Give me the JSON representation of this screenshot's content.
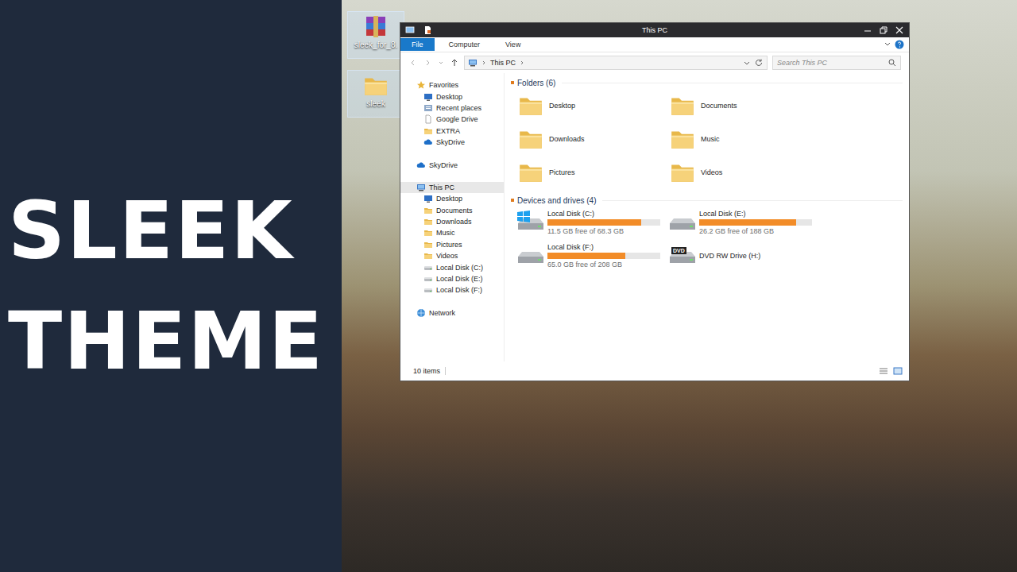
{
  "banner": {
    "lines": [
      "SLEEK",
      "THEME"
    ]
  },
  "desktop_icons": [
    {
      "label": "sleek_for_8.",
      "kind": "archive",
      "selected": true
    },
    {
      "label": "sleek",
      "kind": "folder",
      "selected": true
    }
  ],
  "window": {
    "title": "This PC"
  },
  "ribbon_tabs": [
    {
      "label": "File",
      "selected": true
    },
    {
      "label": "Computer",
      "selected": false
    },
    {
      "label": "View",
      "selected": false
    }
  ],
  "address": {
    "path": "This PC"
  },
  "search": {
    "placeholder": "Search This PC"
  },
  "sidebar": [
    {
      "label": "Favorites",
      "kind": "star",
      "selected": false,
      "items": [
        {
          "label": "Desktop",
          "kind": "desktop",
          "selected": false
        },
        {
          "label": "Recent places",
          "kind": "recent",
          "selected": false
        },
        {
          "label": "Google Drive",
          "kind": "file",
          "selected": false
        },
        {
          "label": "EXTRA",
          "kind": "folder",
          "selected": false
        },
        {
          "label": "SkyDrive",
          "kind": "cloud",
          "selected": false
        }
      ]
    },
    {
      "label": "SkyDrive",
      "kind": "cloud",
      "selected": false,
      "items": []
    },
    {
      "label": "This PC",
      "kind": "pc",
      "selected": true,
      "items": [
        {
          "label": "Desktop",
          "kind": "desktop",
          "selected": false
        },
        {
          "label": "Documents",
          "kind": "folder",
          "selected": false
        },
        {
          "label": "Downloads",
          "kind": "folder",
          "selected": false
        },
        {
          "label": "Music",
          "kind": "folder",
          "selected": false
        },
        {
          "label": "Pictures",
          "kind": "folder",
          "selected": false
        },
        {
          "label": "Videos",
          "kind": "folder",
          "selected": false
        },
        {
          "label": "Local Disk (C:)",
          "kind": "disk",
          "selected": false
        },
        {
          "label": "Local Disk (E:)",
          "kind": "disk",
          "selected": false
        },
        {
          "label": "Local Disk (F:)",
          "kind": "disk",
          "selected": false
        }
      ]
    },
    {
      "label": "Network",
      "kind": "network",
      "selected": false,
      "items": []
    }
  ],
  "folders": {
    "header": "Folders (6)",
    "items": [
      "Desktop",
      "Documents",
      "Downloads",
      "Music",
      "Pictures",
      "Videos"
    ]
  },
  "drives": {
    "header": "Devices and drives (4)",
    "items": [
      {
        "name": "Local Disk (C:)",
        "kind": "system",
        "level": 0.83,
        "space": "11.5 GB free of 68.3 GB",
        "badge": ""
      },
      {
        "name": "Local Disk (E:)",
        "kind": "disk",
        "level": 0.86,
        "space": "26.2 GB free of 188 GB",
        "badge": ""
      },
      {
        "name": "Local Disk (F:)",
        "kind": "disk",
        "level": 0.69,
        "space": "65.0 GB free of 208 GB",
        "badge": ""
      },
      {
        "name": "DVD RW Drive (H:)",
        "kind": "dvd",
        "level": 0,
        "space": "",
        "badge": "DVD"
      }
    ]
  },
  "status_bar": {
    "count": "10 items"
  }
}
